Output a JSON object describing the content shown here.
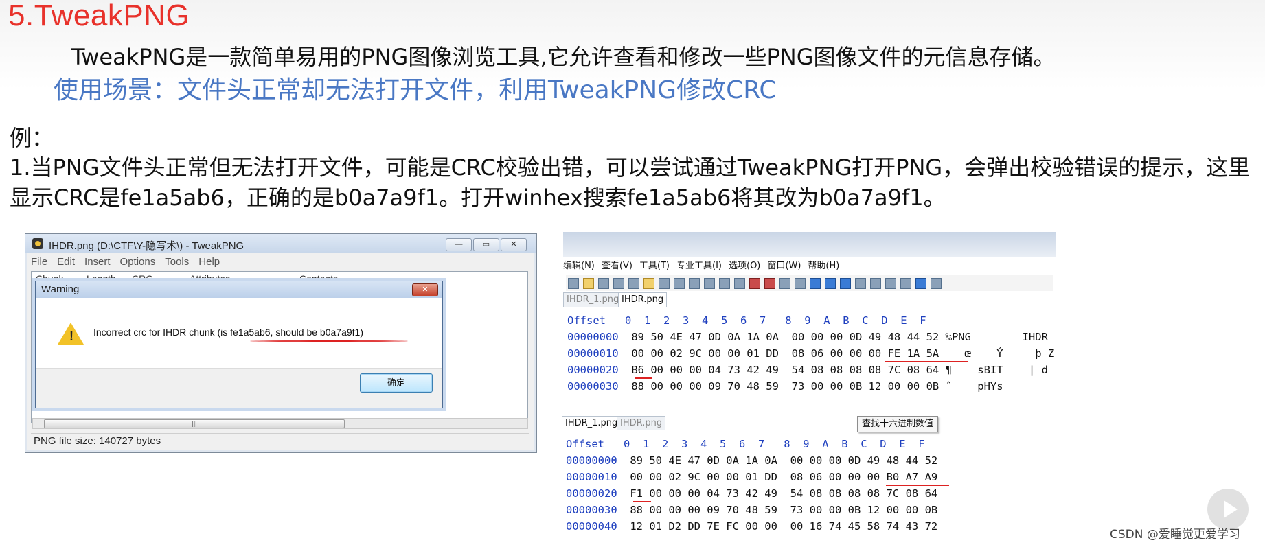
{
  "slide": {
    "title": "5.TweakPNG",
    "intro": "TweakPNG是一款简单易用的PNG图像浏览工具,它允许查看和修改一些PNG图像文件的元信息存储。",
    "scenario": "使用场景：文件头正常却无法打开文件，利用TweakPNG修改CRC",
    "example_label": "例：",
    "step_text": "1.当PNG文件头正常但无法打开文件，可能是CRC校验出错，可以尝试通过TweakPNG打开PNG，会弹出校验错误的提示，这里显示CRC是fe1a5ab6，正确的是b0a7a9f1。打开winhex搜索fe1a5ab6将其改为b0a7a9f1。"
  },
  "tweakpng": {
    "title": "IHDR.png (D:\\CTF\\Y-隐写术\\) - TweakPNG",
    "menu": [
      "File",
      "Edit",
      "Insert",
      "Options",
      "Tools",
      "Help"
    ],
    "columns": [
      "Chunk",
      "Length",
      "CRC",
      "Attributes",
      "Contents"
    ],
    "status": "PNG file size: 140727 bytes",
    "scroll_grip": "|||",
    "dialog": {
      "title": "Warning",
      "close": "✕",
      "message": "Incorrect crc for IHDR chunk (is fe1a5ab6, should be b0a7a9f1)",
      "ok_label": "确定"
    }
  },
  "winhex_before": {
    "menu": [
      "编辑(N)",
      "查看(V)",
      "工具(T)",
      "专业工具(I)",
      "选项(O)",
      "窗口(W)",
      "帮助(H)"
    ],
    "tabs": [
      "IHDR_1.png",
      "IHDR.png"
    ],
    "header": {
      "offset": "Offset",
      "cols": " 0  1  2  3  4  5  6  7   8  9  A  B  C  D  E  F"
    },
    "rows": [
      {
        "offset": "00000000",
        "hex": "89 50 4E 47 0D 0A 1A 0A  00 00 00 0D 49 48 44 52",
        "ascii": "‰PNG        IHDR"
      },
      {
        "offset": "00000010",
        "hex": "00 00 02 9C 00 00 01 DD  08 06 00 00 00 FE 1A 5A",
        "ascii": "   œ    Ý     þ Z"
      },
      {
        "offset": "00000020",
        "hex": "B6 00 00 00 04 73 42 49  54 08 08 08 08 7C 08 64",
        "ascii": "¶    sBIT    | d"
      },
      {
        "offset": "00000030",
        "hex": "88 00 00 00 09 70 48 59  73 00 00 0B 12 00 00 0B",
        "ascii": "ˆ    pHYs"
      }
    ]
  },
  "winhex_after": {
    "tabs": [
      "IHDR_1.png",
      "IHDR.png"
    ],
    "find_tooltip": "查找十六进制数值",
    "header": {
      "offset": "Offset",
      "cols": " 0  1  2  3  4  5  6  7   8  9  A  B  C  D  E  F"
    },
    "rows": [
      {
        "offset": "00000000",
        "hex": "89 50 4E 47 0D 0A 1A 0A  00 00 00 0D 49 48 44 52"
      },
      {
        "offset": "00000010",
        "hex": "00 00 02 9C 00 00 01 DD  08 06 00 00 00 B0 A7 A9"
      },
      {
        "offset": "00000020",
        "hex": "F1 00 00 00 04 73 42 49  54 08 08 08 08 7C 08 64"
      },
      {
        "offset": "00000030",
        "hex": "88 00 00 00 09 70 48 59  73 00 00 0B 12 00 00 0B"
      },
      {
        "offset": "00000040",
        "hex": "12 01 D2 DD 7E FC 00 00  00 16 74 45 58 74 43 72"
      }
    ]
  },
  "watermark": "CSDN @爱睡觉更爱学习",
  "colors": {
    "title": "#e8322b",
    "scenario": "#4a78c4",
    "hex_offset": "#1e3fbf",
    "highlight_line": "#d22222"
  }
}
